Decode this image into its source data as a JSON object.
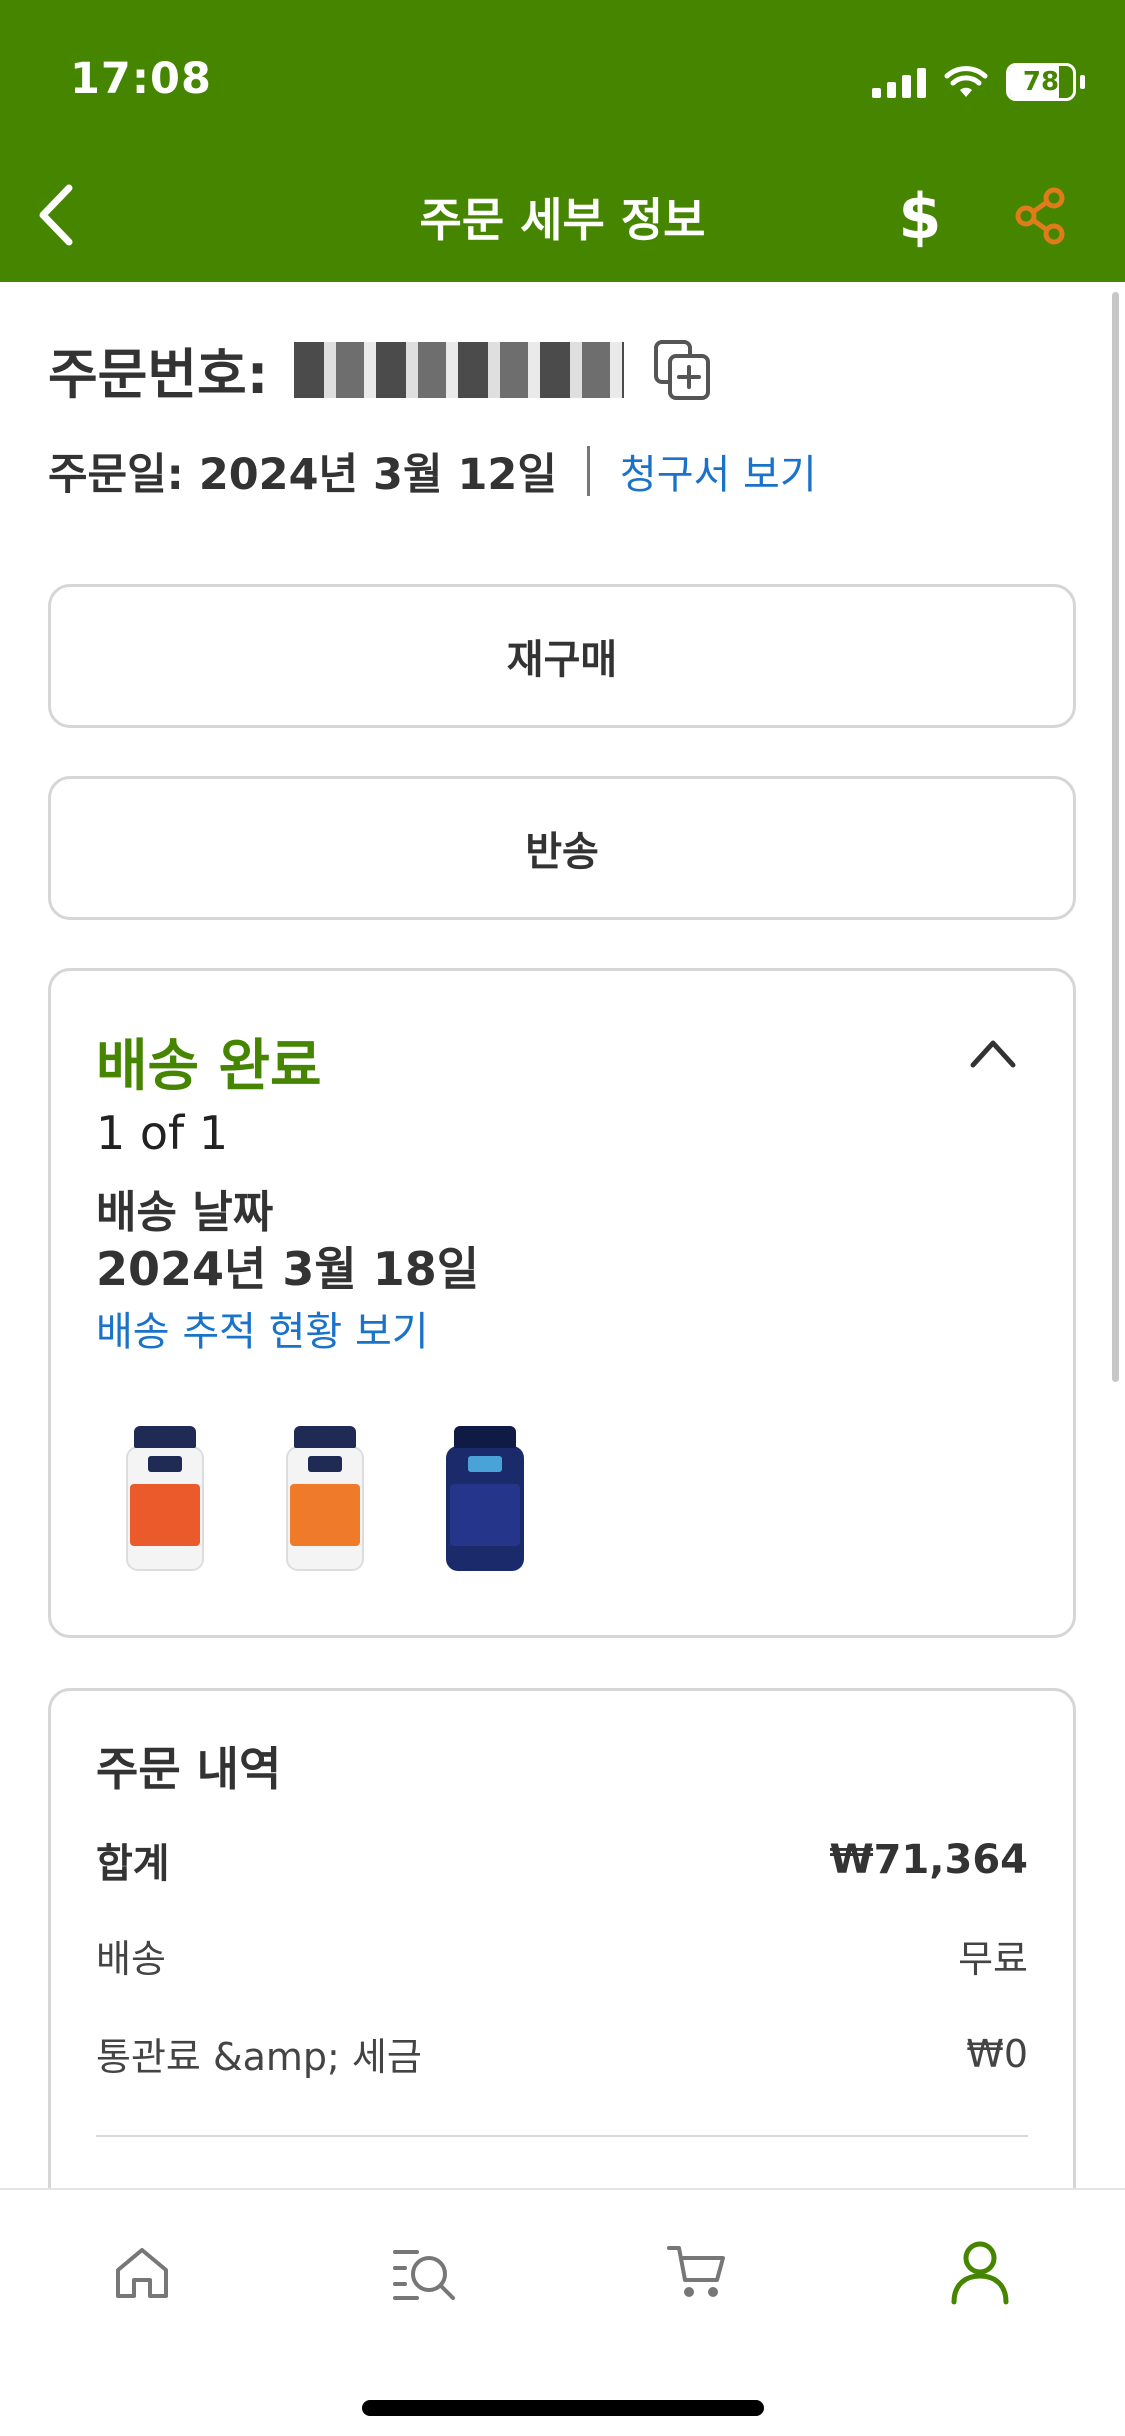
{
  "status_bar": {
    "time": "17:08",
    "battery": "78",
    "battery_level": 0.78
  },
  "header": {
    "title": "주문 세부 정보",
    "dollar_symbol": "$",
    "bg_color": "#458500",
    "share_color": "#e07b1a"
  },
  "order": {
    "number_label": "주문번호:",
    "date": "주문일: 2024년 3월 12일",
    "invoice_link": "청구서 보기"
  },
  "actions": {
    "reorder": "재구매",
    "return": "반송"
  },
  "shipment": {
    "status": "배송 완료",
    "count": "1 of 1",
    "date_label": "배송 날짜",
    "date": "2024년 3월 18일",
    "tracking_link": "배송 추적 현황 보기"
  },
  "summary": {
    "title": "주문 내역",
    "rows": [
      {
        "label": "합계",
        "value": "₩71,364"
      },
      {
        "label": "배송",
        "value": "무료"
      },
      {
        "label": "통관료 &amp; 세금",
        "value": "₩0"
      }
    ]
  },
  "tabs": [
    "home-icon",
    "search-list-icon",
    "cart-icon",
    "account-icon"
  ],
  "colors": {
    "accent": "#458500",
    "link": "#1a73c9"
  }
}
